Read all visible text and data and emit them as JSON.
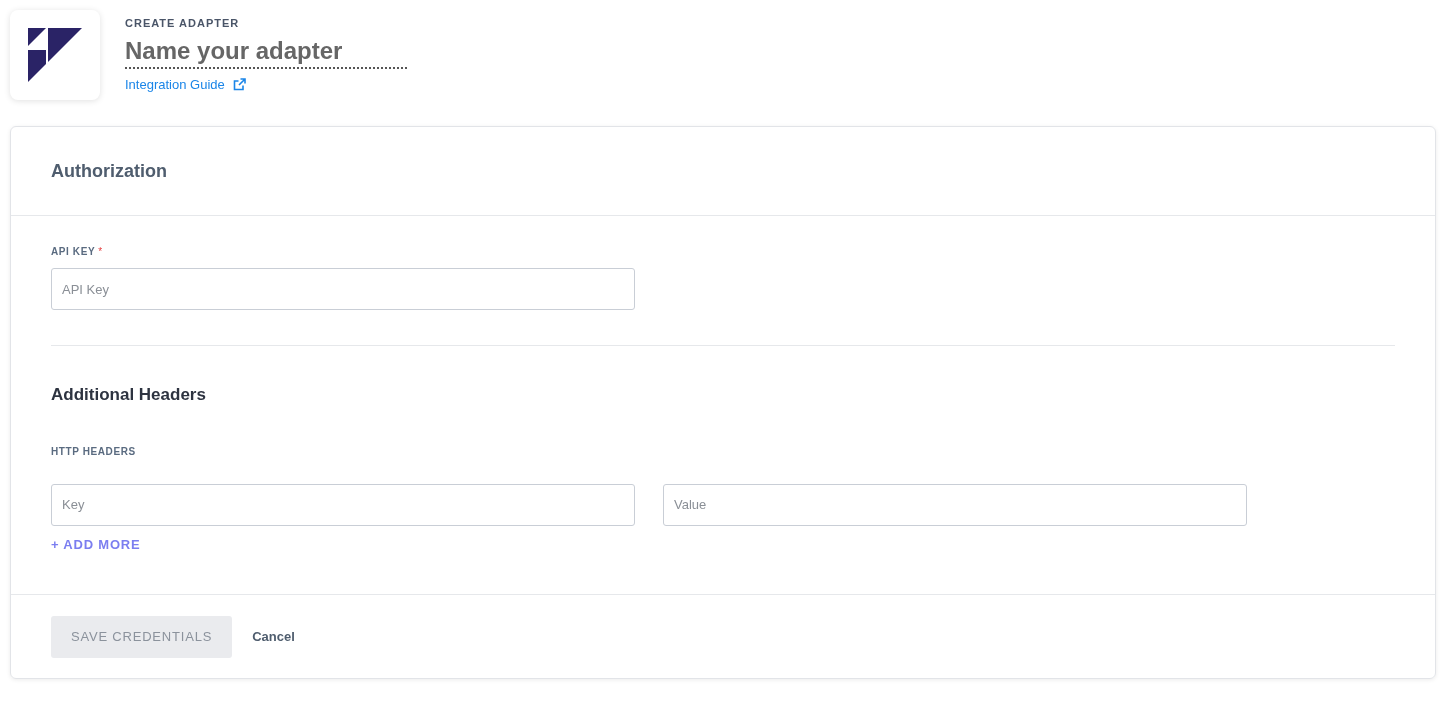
{
  "header": {
    "eyebrow": "CREATE ADAPTER",
    "name_field": {
      "placeholder": "Name your adapter"
    },
    "guide_link": "Integration Guide"
  },
  "card": {
    "title": "Authorization",
    "api_key": {
      "label": "API KEY",
      "required_mark": "*",
      "placeholder": "API Key"
    },
    "additional": {
      "title": "Additional Headers",
      "label": "HTTP HEADERS",
      "key_placeholder": "Key",
      "value_placeholder": "Value",
      "add_more": "+ ADD MORE"
    },
    "footer": {
      "save": {
        "label": "SAVE CREDENTIALS",
        "disabled": true
      },
      "cancel": "Cancel"
    }
  }
}
